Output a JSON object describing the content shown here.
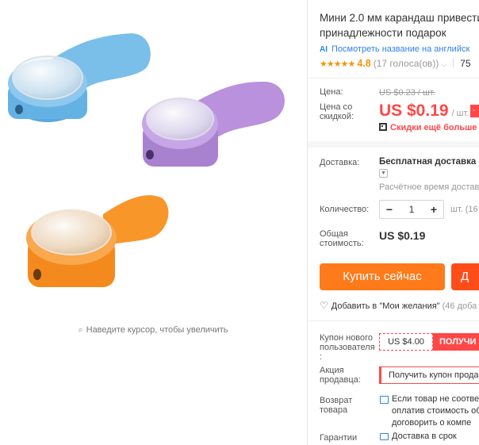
{
  "gallery": {
    "zoom_hint": "Наведите курсор, чтобы увеличить",
    "zoom_icon": "magnifier-icon",
    "colors": {
      "blue": "#6fb7e6",
      "purple": "#b58ed8",
      "orange": "#f7982c"
    }
  },
  "product": {
    "title_line1": "Мини 2.0 мм карандаш привести",
    "title_line2": "принадлежности подарок",
    "translate_icon": "AI",
    "translate_link": "Посмотреть название на английск",
    "stars": "★★★★★",
    "rating": "4.8",
    "votes": "(17 голоса(ов))",
    "orders": "75"
  },
  "pricing": {
    "price_label": "Цена:",
    "old_price": "US $0.23 / шт.",
    "discount_label_line1": "Цена со",
    "discount_label_line2": "скидкой:",
    "price": "US $0.19",
    "unit": "/ шт.",
    "discount_tag": "-",
    "more_discounts": "Скидки ещё больше в"
  },
  "shipping": {
    "label": "Доставка:",
    "value": "Бесплатная доставка в",
    "estimated": "Расчётное время доставк"
  },
  "quantity": {
    "label": "Количество:",
    "minus": "−",
    "value": "1",
    "plus": "+",
    "unit": "шт. (16"
  },
  "total": {
    "label_line1": "Общая",
    "label_line2": "стоимость:",
    "value": "US $0.19"
  },
  "actions": {
    "buy_now": "Купить сейчас",
    "add_to_cart": "Д",
    "wishlist": "Добавить в \"Мои желания\"",
    "wishlist_count": "(46 доба"
  },
  "coupons": {
    "new_user_label_line1": "Купон нового",
    "new_user_label_line2": "пользователя",
    "new_user_label_line3": ":",
    "new_user_value": "US $4.00",
    "new_user_action": "ПОЛУЧИ",
    "seller_label_line1": "Акция",
    "seller_label_line2": "продавца:",
    "seller_coupon": "Получить купон прода"
  },
  "returns": {
    "label_line1": "Возврат",
    "label_line2": "товара",
    "text_line1": "Если товар не соответ",
    "text_line2": "оплатив стоимость об",
    "text_line3": "договорить о компе"
  },
  "guarantee": {
    "label": "Гарантии",
    "text": "Доставка в срок"
  }
}
